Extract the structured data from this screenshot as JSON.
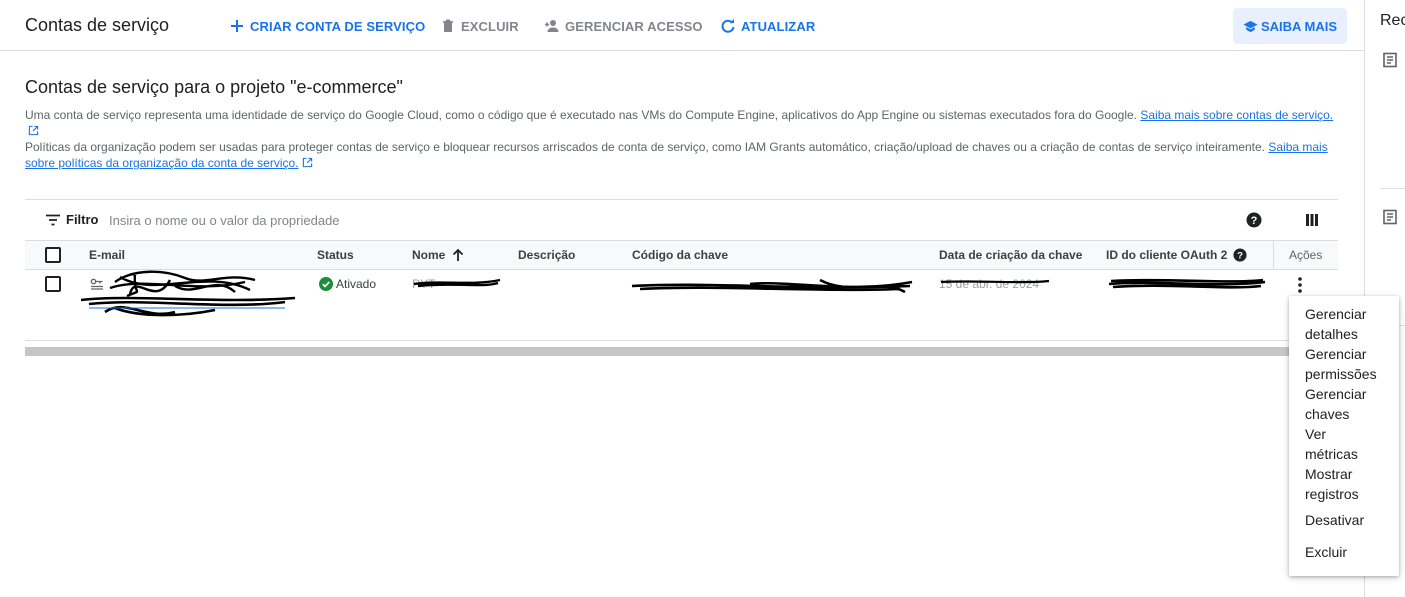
{
  "toolbar": {
    "title": "Contas de serviço",
    "create_label": "CRIAR CONTA DE SERVIÇO",
    "delete_label": "EXCLUIR",
    "manage_access_label": "GERENCIAR ACESSO",
    "refresh_label": "ATUALIZAR",
    "learn_more_label": "SAIBA MAIS"
  },
  "side_panel": {
    "title": "Rec"
  },
  "main": {
    "heading": "Contas de serviço para o projeto \"e-commerce\"",
    "intro_text": "Uma conta de serviço representa uma identidade de serviço do Google Cloud, como o código que é executado nas VMs do Compute Engine, aplicativos do App Engine ou sistemas executados fora do Google.",
    "intro_link": "Saiba mais sobre contas de serviço.",
    "policy_text": "Políticas da organização podem ser usadas para proteger contas de serviço e bloquear recursos arriscados de conta de serviço, como IAM Grants automático, criação/upload de chaves ou a criação de contas de serviço inteiramente.",
    "policy_link_1": "Saiba mais",
    "policy_link_2": "sobre políticas da organização da conta de serviço."
  },
  "filter": {
    "label": "Filtro",
    "placeholder": "Insira o nome ou o valor da propriedade"
  },
  "table": {
    "columns": {
      "email": "E-mail",
      "status": "Status",
      "name": "Nome",
      "description": "Descrição",
      "key_id": "Código da chave",
      "key_created": "Data de criação da chave",
      "oauth_id": "ID do cliente OAuth 2",
      "actions": "Ações"
    },
    "rows": [
      {
        "status": "Ativado",
        "name_visible": "PYT",
        "key_date_visible": "15 de abr. de 2024"
      }
    ]
  },
  "menu": {
    "items": [
      "Gerenciar detalhes",
      "Gerenciar permissões",
      "Gerenciar chaves",
      "Ver métricas",
      "Mostrar registros",
      "Desativar",
      "Excluir"
    ]
  },
  "colors": {
    "accent": "#1a73e8",
    "status_green": "#1e8e3e",
    "learn_more_bg": "#e8f0fe"
  },
  "icons": [
    "add-icon",
    "trash-icon",
    "person-add-icon",
    "refresh-icon",
    "school-icon",
    "filter-icon",
    "help-icon",
    "columns-icon",
    "check-circle-icon",
    "service-account-icon",
    "arrow-up-icon",
    "more-vert-icon",
    "external-link-icon",
    "document-icon"
  ]
}
